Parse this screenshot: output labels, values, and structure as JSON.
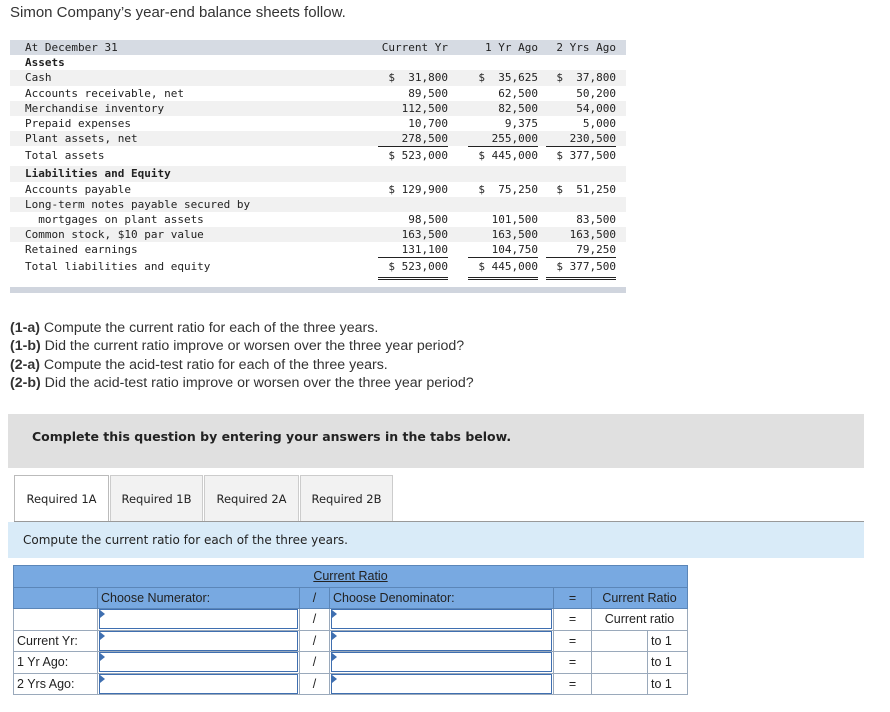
{
  "intro": "Simon Company’s year-end balance sheets follow.",
  "balance_sheet": {
    "header": {
      "label": "At December 31",
      "cols": [
        "Current Yr",
        "1 Yr Ago",
        "2 Yrs Ago"
      ]
    },
    "assets_heading": "Assets",
    "assets": [
      {
        "label": "Cash",
        "values": [
          "$  31,800",
          "$  35,625",
          "$  37,800"
        ]
      },
      {
        "label": "Accounts receivable, net",
        "values": [
          "89,500",
          "62,500",
          "50,200"
        ]
      },
      {
        "label": "Merchandise inventory",
        "values": [
          "112,500",
          "82,500",
          "54,000"
        ]
      },
      {
        "label": "Prepaid expenses",
        "values": [
          "10,700",
          "9,375",
          "5,000"
        ]
      },
      {
        "label": "Plant assets, net",
        "values": [
          "278,500",
          "255,000",
          "230,500"
        ]
      }
    ],
    "total_assets": {
      "label": "Total assets",
      "values": [
        "$ 523,000",
        "$ 445,000",
        "$ 377,500"
      ]
    },
    "liab_heading": "Liabilities and Equity",
    "accounts_payable": {
      "label": "Accounts payable",
      "values": [
        "$ 129,900",
        "$  75,250",
        "$  51,250"
      ]
    },
    "lt_notes_line1": "Long-term notes payable secured by",
    "lt_notes": {
      "label": "  mortgages on plant assets",
      "values": [
        "98,500",
        "101,500",
        "83,500"
      ]
    },
    "common_stock": {
      "label": "Common stock, $10 par value",
      "values": [
        "163,500",
        "163,500",
        "163,500"
      ]
    },
    "retained_earnings": {
      "label": "Retained earnings",
      "values": [
        "131,100",
        "104,750",
        "79,250"
      ]
    },
    "total_le": {
      "label": "Total liabilities and equity",
      "values": [
        "$ 523,000",
        "$ 445,000",
        "$ 377,500"
      ]
    }
  },
  "questions": [
    {
      "tag": "(1-a)",
      "text": " Compute the current ratio for each of the three years."
    },
    {
      "tag": "(1-b)",
      "text": " Did the current ratio improve or worsen over the three year period?"
    },
    {
      "tag": "(2-a)",
      "text": " Compute the acid-test ratio for each of the three years."
    },
    {
      "tag": "(2-b)",
      "text": " Did the acid-test ratio improve or worsen over the three year period?"
    }
  ],
  "banner": "Complete this question by entering your answers in the tabs below.",
  "tabs": [
    {
      "label": "Required 1A",
      "active": true
    },
    {
      "label": "Required 1B",
      "active": false
    },
    {
      "label": "Required 2A",
      "active": false
    },
    {
      "label": "Required 2B",
      "active": false
    }
  ],
  "task_text": "Compute the current ratio for each of the three years.",
  "answer_table": {
    "title": "Current Ratio",
    "numerator_header": "Choose Numerator:",
    "slash": "/",
    "denominator_header": "Choose Denominator:",
    "equals": "=",
    "result_header": "Current Ratio",
    "result_sub": "Current ratio",
    "rows": [
      {
        "label": "Current Yr:",
        "numerator": "",
        "denominator": "",
        "result": "",
        "suffix": "to 1"
      },
      {
        "label": "1 Yr Ago:",
        "numerator": "",
        "denominator": "",
        "result": "",
        "suffix": "to 1"
      },
      {
        "label": "2 Yrs Ago:",
        "numerator": "",
        "denominator": "",
        "result": "",
        "suffix": "to 1"
      }
    ]
  }
}
